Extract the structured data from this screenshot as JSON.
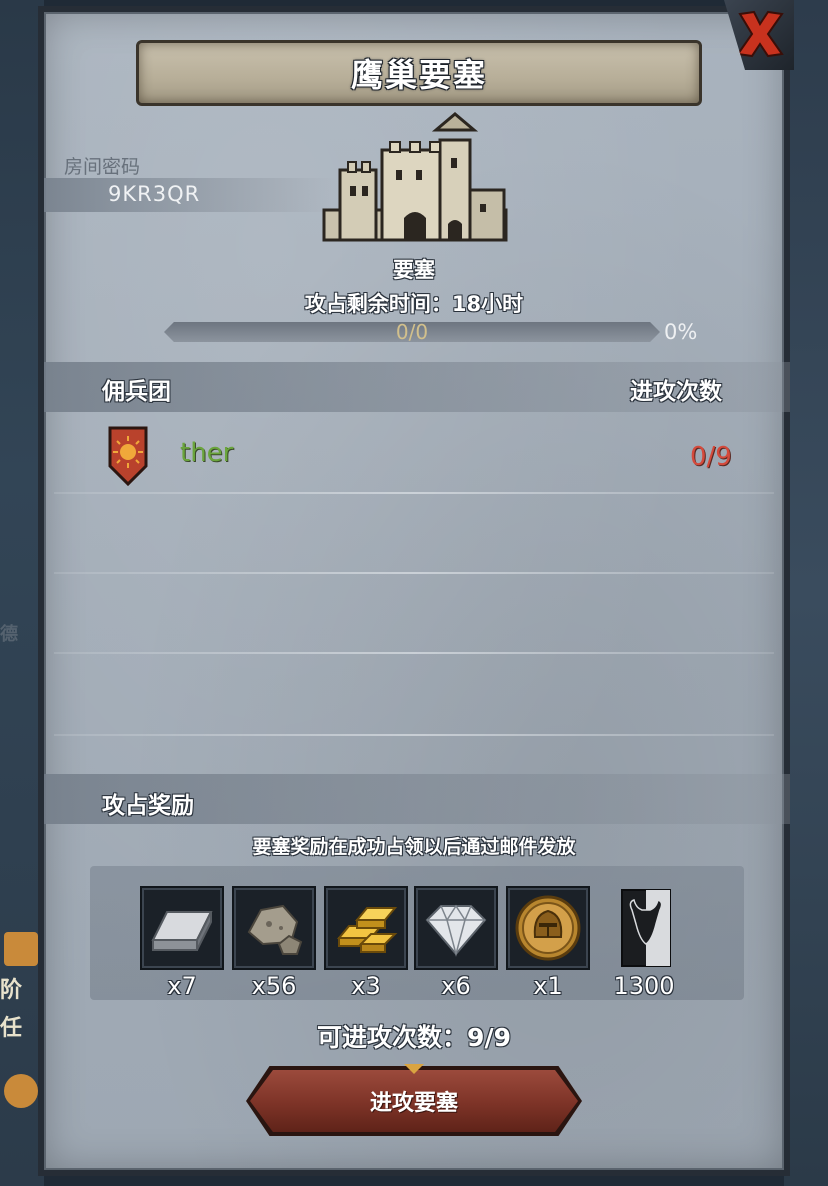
{
  "title": "鹰巢要塞",
  "room": {
    "label": "房间密码",
    "code": "9KR3QR"
  },
  "fortress": {
    "name": "要塞",
    "time_label": "攻占剩余时间：",
    "time_value": "18",
    "time_unit": "小时",
    "progress_text": "0/0",
    "progress_percent": "0%",
    "progress_fraction": 0
  },
  "mercenary_section": {
    "title": "佣兵团",
    "attack_count_header": "进攻次数",
    "rows": [
      {
        "name": "ther",
        "count": "0/9"
      }
    ]
  },
  "reward_section": {
    "title": "攻占奖励",
    "note": "要塞奖励在成功占领以后通过邮件发放",
    "items": [
      {
        "icon": "iron-ingot-icon",
        "qty": "x7"
      },
      {
        "icon": "stone-ore-icon",
        "qty": "x56"
      },
      {
        "icon": "gold-bars-icon",
        "qty": "x3"
      },
      {
        "icon": "diamond-icon",
        "qty": "x6"
      },
      {
        "icon": "knight-helmet-coin-icon",
        "qty": "x1"
      },
      {
        "icon": "bull-banner-icon",
        "qty": "1300"
      }
    ]
  },
  "attack_times": {
    "label": "可进攻次数：",
    "value": "9/9"
  },
  "attack_button": {
    "label": "进攻要塞"
  },
  "side": {
    "left_text_1": "阶",
    "left_text_2": "任",
    "left_text_3": "德"
  },
  "colors": {
    "panel": "#a4aeb9",
    "merc_name": "#6aa53c",
    "merc_count": "#d44a3c",
    "button": "#7d3327",
    "close_x": "#c8321e"
  }
}
